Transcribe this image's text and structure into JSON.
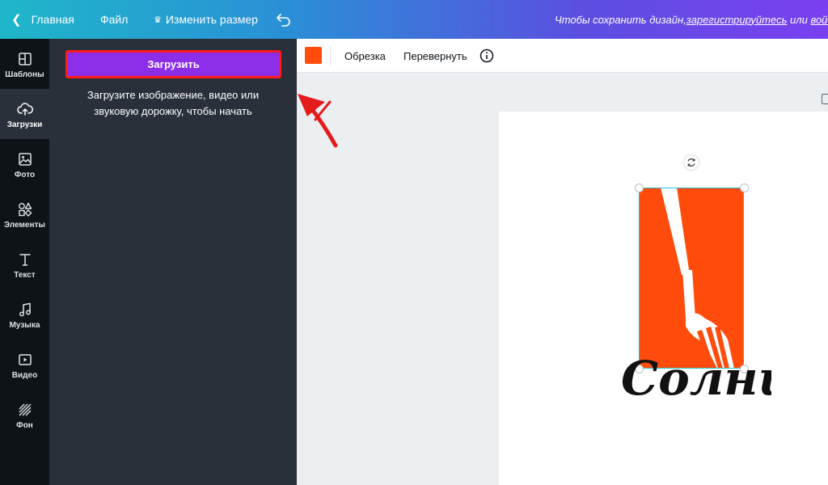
{
  "topbar": {
    "home_label": "Главная",
    "file_label": "Файл",
    "resize_label": "Изменить размер",
    "notice_prefix": "Чтобы сохранить дизайн, ",
    "notice_register": "зарегистрируйтесь",
    "notice_or": " или ",
    "notice_login": "войдите"
  },
  "rail": {
    "items": [
      {
        "label": "Шаблоны",
        "icon": "layout-icon"
      },
      {
        "label": "Загрузки",
        "icon": "cloud-upload-icon"
      },
      {
        "label": "Фото",
        "icon": "photo-icon"
      },
      {
        "label": "Элементы",
        "icon": "shapes-icon"
      },
      {
        "label": "Текст",
        "icon": "text-icon"
      },
      {
        "label": "Музыка",
        "icon": "music-icon"
      },
      {
        "label": "Видео",
        "icon": "video-icon"
      },
      {
        "label": "Фон",
        "icon": "background-pattern-icon"
      }
    ],
    "active": "Загрузки"
  },
  "panel": {
    "upload_button": "Загрузить",
    "hint": "Загрузите изображение, видео или звуковую дорожку, чтобы начать"
  },
  "toolbar": {
    "color": "#ff4c0c",
    "crop_label": "Обрезка",
    "flip_label": "Перевернуть"
  },
  "design": {
    "logo_text": "Солнце",
    "accent_color": "#ff4c0c",
    "selection_color": "#21c4d4"
  }
}
